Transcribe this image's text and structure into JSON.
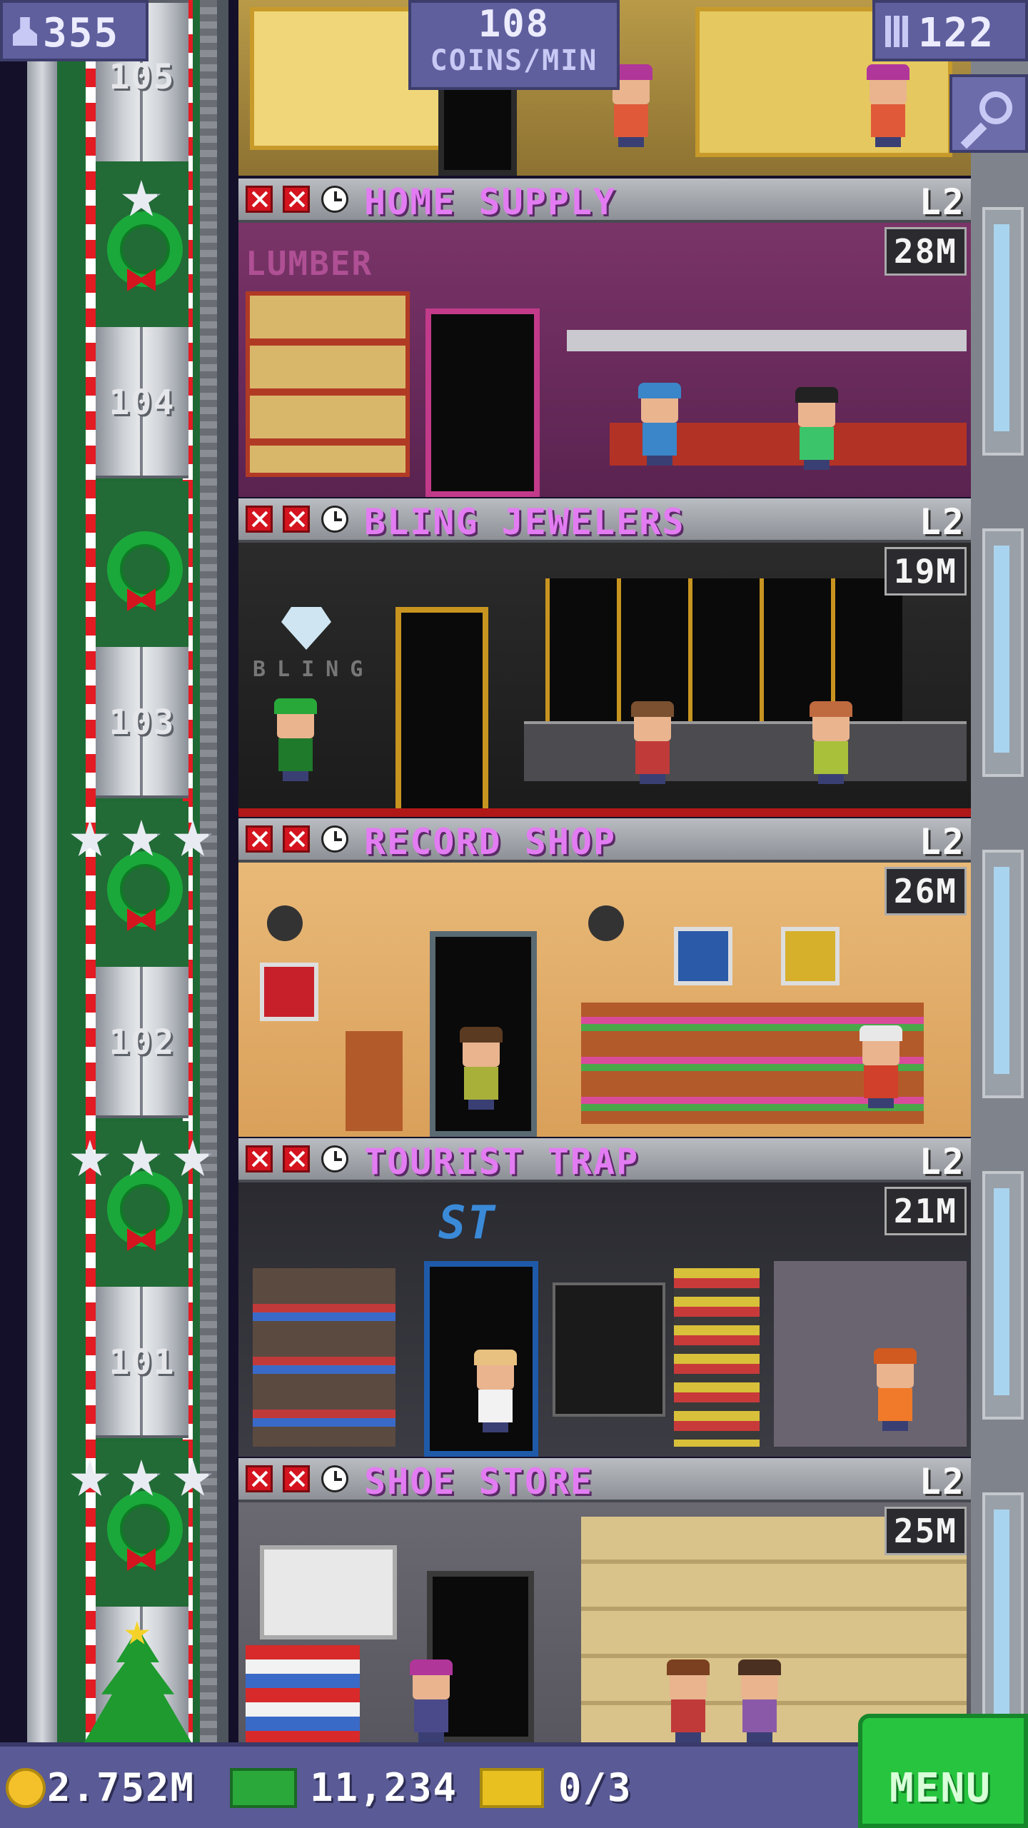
{
  "hud": {
    "population": "355",
    "coins_per_min_value": "108",
    "coins_per_min_unit": "COINS/MIN",
    "bux_count": "122"
  },
  "elevator": {
    "floor_numbers": [
      "105",
      "104",
      "103",
      "102",
      "101"
    ]
  },
  "top_floor": {
    "name": "",
    "partial": true
  },
  "floors": [
    {
      "name": "HOME SUPPLY",
      "level": "L2",
      "stock": "28M",
      "scene_text": "LUMBER"
    },
    {
      "name": "BLING JEWELERS",
      "level": "L2",
      "stock": "19M",
      "scene_text": "BLING"
    },
    {
      "name": "RECORD SHOP",
      "level": "L2",
      "stock": "26M"
    },
    {
      "name": "TOURIST TRAP",
      "level": "L2",
      "stock": "21M",
      "scene_text": "ST"
    },
    {
      "name": "SHOE STORE",
      "level": "L2",
      "stock": "25M"
    }
  ],
  "bottom": {
    "coins": "2.752M",
    "bux": "11,234",
    "tickets": "0/3",
    "menu_label": "MENU"
  },
  "colors": {
    "store_name": "#e37cf2",
    "hud_bg": "#5f5f9e",
    "menu_bg": "#27c43f",
    "elevator_green": "#1f6a34"
  }
}
